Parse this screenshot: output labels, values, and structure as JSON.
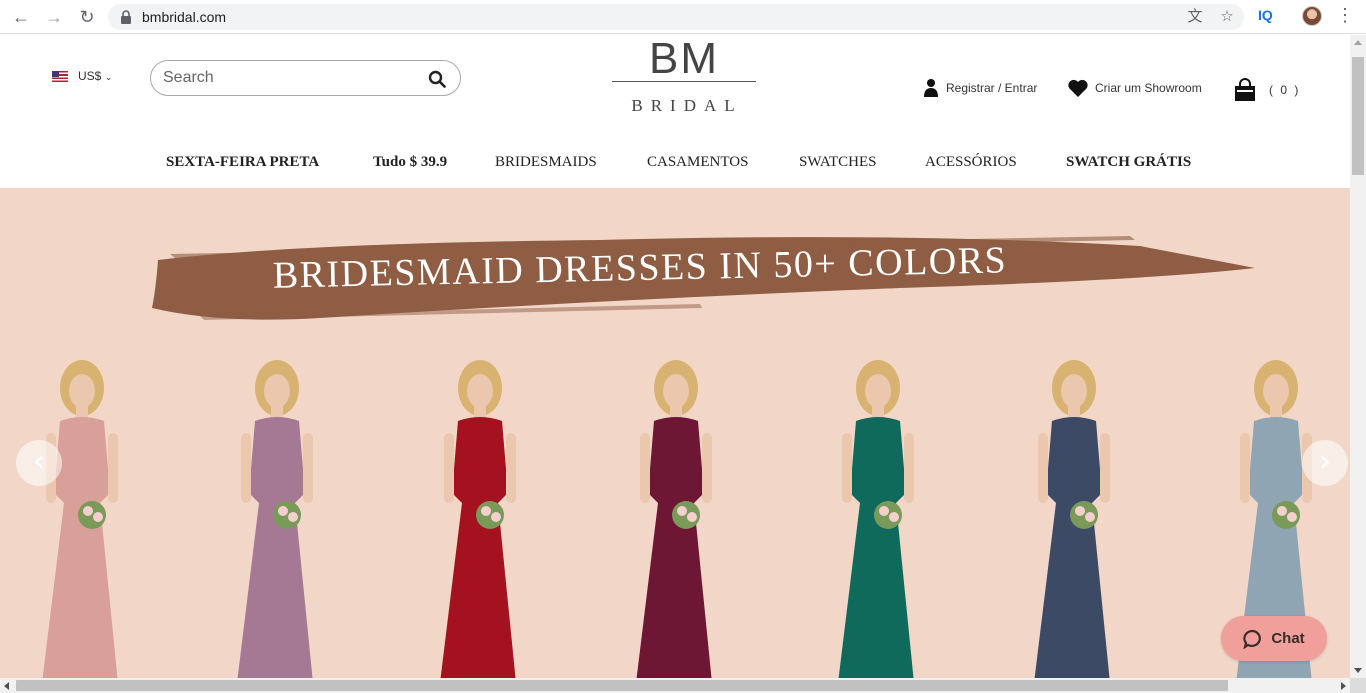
{
  "browser": {
    "url": "bmbridal.com",
    "extension_label": "IQ"
  },
  "header": {
    "currency": "US$",
    "search_placeholder": "Search",
    "logo_top": "BM",
    "logo_bottom": "BRIDAL",
    "register_label": "Registrar / Entrar",
    "showroom_label": "Criar um Showroom",
    "cart_count": "( 0 )"
  },
  "nav": {
    "items": [
      {
        "label": "SEXTA-FEIRA PRETA"
      },
      {
        "label": "Tudo $ 39.9"
      },
      {
        "label": "BRIDESMAIDS"
      },
      {
        "label": "CASAMENTOS"
      },
      {
        "label": "SWATCHES"
      },
      {
        "label": "ACESSÓRIOS"
      },
      {
        "label": "SWATCH GRÁTIS"
      }
    ]
  },
  "hero": {
    "title": "BRIDESMAID DRESSES IN 50+ COLORS",
    "background": "#f2d7c9",
    "brush_color": "#8e5d43",
    "dress_colors": [
      "#d9a09a",
      "#a57993",
      "#a3121e",
      "#6e1735",
      "#0f6a5c",
      "#3d4a66",
      "#8fa5b4"
    ]
  },
  "chat": {
    "label": "Chat",
    "color": "#f19f9a"
  },
  "icons": {
    "back": "arrow-left-icon",
    "forward": "arrow-right-icon",
    "reload": "reload-icon",
    "lock": "lock-icon",
    "translate": "translate-icon",
    "bookmark": "star-icon",
    "search": "search-icon",
    "user": "user-icon",
    "heart": "heart-icon",
    "cart": "shopping-bag-icon",
    "chat": "chat-bubble-icon"
  }
}
